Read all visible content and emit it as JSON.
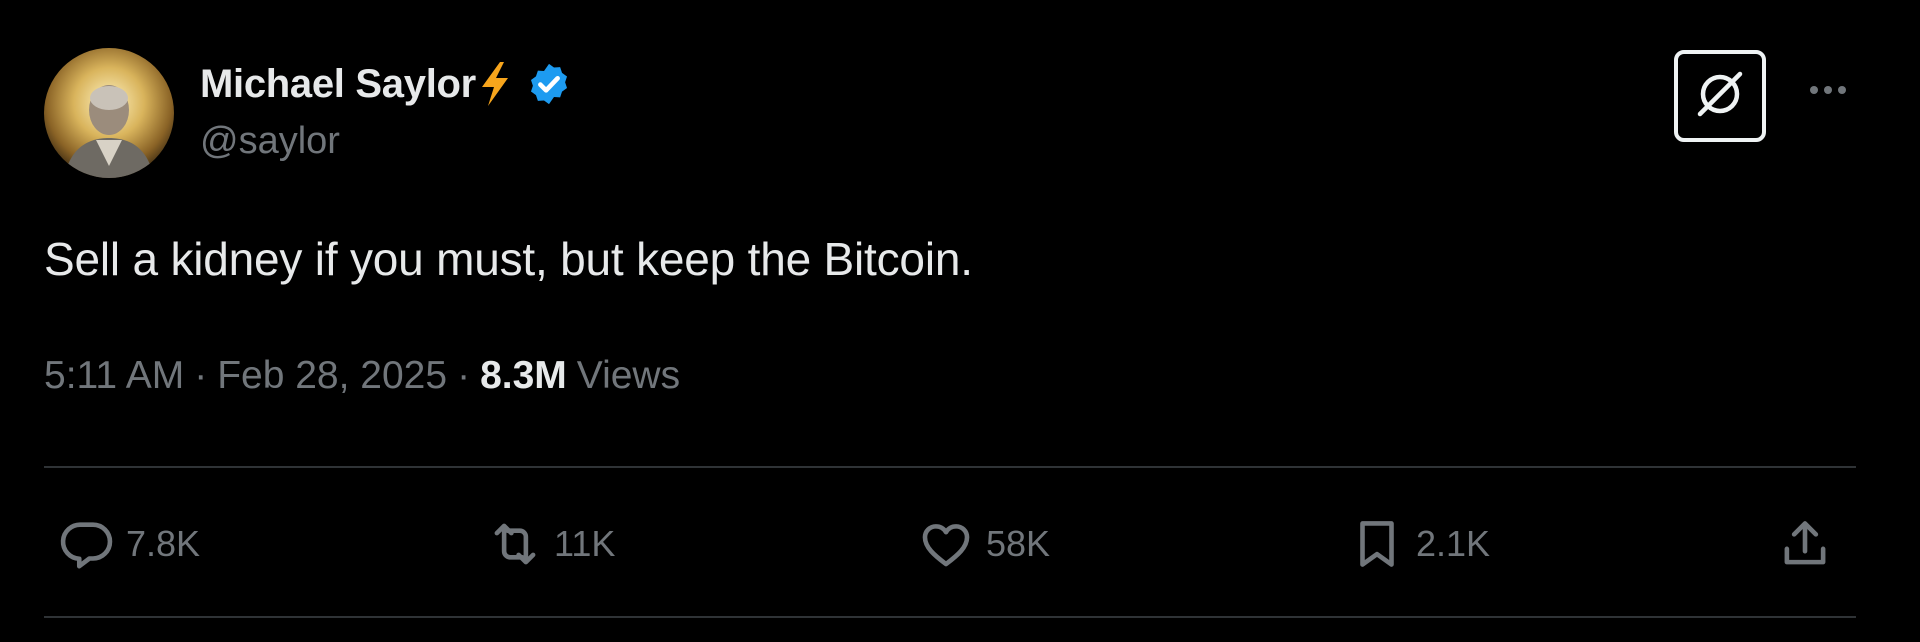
{
  "author": {
    "display_name": "Michael Saylor",
    "emoji": "lightning-bolt",
    "verified": true,
    "handle": "@saylor"
  },
  "tweet": {
    "text": "Sell a kidney if you must, but keep the Bitcoin.",
    "time": "5:11 AM",
    "date": "Feb 28, 2025",
    "separator": "·",
    "views_count": "8.3M",
    "views_label": "Views"
  },
  "actions": {
    "replies": "7.8K",
    "reposts": "11K",
    "likes": "58K",
    "bookmarks": "2.1K"
  },
  "icons": {
    "avatar": "avatar",
    "grok": "grok-icon",
    "more": "more-horizontal-icon",
    "reply": "reply-icon",
    "repost": "repost-icon",
    "like": "heart-icon",
    "bookmark": "bookmark-icon",
    "share": "share-icon"
  },
  "colors": {
    "background": "#000000",
    "text": "#e7e9ea",
    "secondary": "#71767b",
    "verified": "#1d9bf0",
    "bolt": "#f7a51c",
    "divider": "#2f3336"
  }
}
